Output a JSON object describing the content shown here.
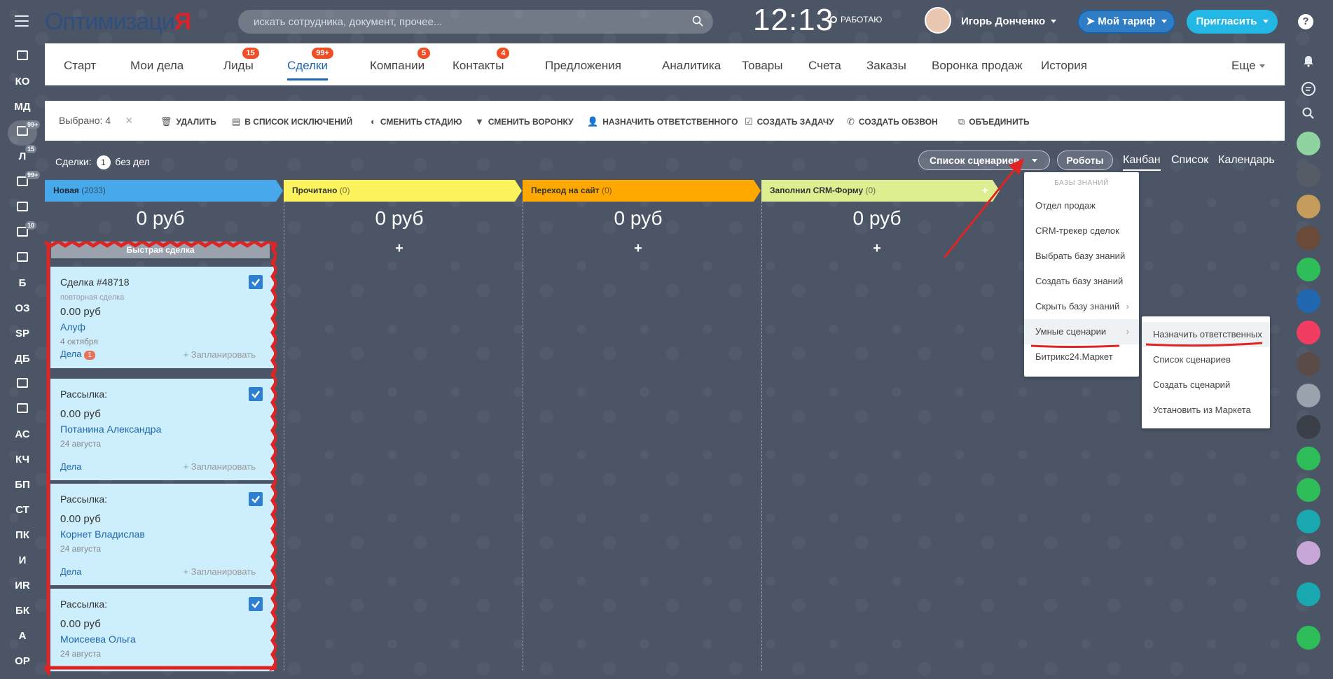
{
  "header": {
    "logo_part1": "Оптимизаци",
    "logo_part2": "Я",
    "search_placeholder": "искать сотрудника, документ, прочее...",
    "time": "12:13",
    "status": "РАБОТАЮ",
    "user_name": "Игорь Донченко",
    "tariff_label": "Мой тариф",
    "invite_label": "Пригласить",
    "help": "?"
  },
  "leftbar": [
    {
      "label": "",
      "type": "icon",
      "icon": "monitor-icon"
    },
    {
      "label": "КО"
    },
    {
      "label": "МД"
    },
    {
      "label": "",
      "type": "icon",
      "icon": "filter-icon",
      "badge": "99+",
      "active": true
    },
    {
      "label": "Л",
      "badge": "15"
    },
    {
      "label": "",
      "type": "icon",
      "icon": "checkbox-icon",
      "badge": "99+"
    },
    {
      "label": "",
      "type": "icon",
      "icon": "book-icon"
    },
    {
      "label": "",
      "type": "icon",
      "icon": "mail-icon",
      "badge": "10"
    },
    {
      "label": "",
      "type": "icon",
      "icon": "robot-icon"
    },
    {
      "label": "Б"
    },
    {
      "label": "ОЗ"
    },
    {
      "label": "SP"
    },
    {
      "label": "ДБ"
    },
    {
      "label": "",
      "type": "icon",
      "icon": "card-icon"
    },
    {
      "label": "",
      "type": "icon",
      "icon": "document-icon"
    },
    {
      "label": "АС"
    },
    {
      "label": "КЧ"
    },
    {
      "label": "БП"
    },
    {
      "label": "СТ"
    },
    {
      "label": "ПК"
    },
    {
      "label": "И"
    },
    {
      "label": "ИR"
    },
    {
      "label": "БК"
    },
    {
      "label": "А"
    },
    {
      "label": "ОР"
    }
  ],
  "tabs": [
    {
      "label": "Старт"
    },
    {
      "label": "Мои дела"
    },
    {
      "label": "Лиды",
      "badge": "15"
    },
    {
      "label": "Сделки",
      "badge": "99+",
      "active": true
    },
    {
      "label": "Компании",
      "badge": "5"
    },
    {
      "label": "Контакты",
      "badge": "4"
    },
    {
      "label": "Предложения"
    },
    {
      "label": "Аналитика"
    },
    {
      "label": "Товары"
    },
    {
      "label": "Счета"
    },
    {
      "label": "Заказы"
    },
    {
      "label": "Воронка продаж"
    },
    {
      "label": "История"
    },
    {
      "label": "Еще"
    }
  ],
  "actions": {
    "selected": "Выбрано: 4",
    "close": "×",
    "items": [
      {
        "label": "УДАЛИТЬ",
        "icon": "trash-icon"
      },
      {
        "label": "В СПИСОК ИСКЛЮЧЕНИЙ",
        "icon": "list-icon"
      },
      {
        "label": "СМЕНИТЬ СТАДИЮ",
        "icon": "stage-icon"
      },
      {
        "label": "СМЕНИТЬ ВОРОНКУ",
        "icon": "funnel-icon"
      },
      {
        "label": "НАЗНАЧИТЬ ОТВЕТСТВЕННОГО",
        "icon": "person-icon"
      },
      {
        "label": "СОЗДАТЬ ЗАДАЧУ",
        "icon": "task-icon"
      },
      {
        "label": "СОЗДАТЬ ОБЗВОН",
        "icon": "phone-icon"
      },
      {
        "label": "ОБЪЕДИНИТЬ",
        "icon": "merge-icon"
      }
    ]
  },
  "toolbar": {
    "deals_prefix": "Сделки:",
    "deals_count": "1",
    "deals_suffix": "без дел",
    "scenarios_label": "Список сценариев",
    "robots_label": "Роботы",
    "views": [
      "Канбан",
      "Список",
      "Календарь"
    ]
  },
  "columns": [
    {
      "name": "Новая",
      "count": "(2033)",
      "sum": "0 руб",
      "color": "#47a8ea",
      "text_color": "#1a2a3a"
    },
    {
      "name": "Прочитано",
      "count": "(0)",
      "sum": "0 руб",
      "color": "#fdf35c",
      "text_color": "#333"
    },
    {
      "name": "Переход на сайт",
      "count": "(0)",
      "sum": "0 руб",
      "color": "#ffa900",
      "text_color": "#333"
    },
    {
      "name": "Заполнил CRM-Форму",
      "count": "(0)",
      "sum": "0 руб",
      "color": "#dcee8f",
      "text_color": "#333"
    }
  ],
  "add_symbol": "+",
  "quick_deal": "Быстрая сделка",
  "cards": [
    {
      "title": "Сделка #48718",
      "subtitle": "повторная сделка",
      "sum": "0.00 руб",
      "client": "Алуф",
      "date": "4 октября",
      "deals": "Дела",
      "deals_badge": "1",
      "plan": "+ Запланировать"
    },
    {
      "title": "Рассылка:",
      "subtitle": "",
      "sum": "0.00 руб",
      "client": "Потанина Александра",
      "date": "24 августа",
      "deals": "Дела",
      "deals_badge": "",
      "plan": "+ Запланировать"
    },
    {
      "title": "Рассылка:",
      "subtitle": "",
      "sum": "0.00 руб",
      "client": "Корнет Владислав",
      "date": "24 августа",
      "deals": "Дела",
      "deals_badge": "",
      "plan": "+ Запланировать"
    },
    {
      "title": "Рассылка:",
      "subtitle": "",
      "sum": "0.00 руб",
      "client": "Моисеева Ольга",
      "date": "24 августа",
      "deals": "",
      "deals_badge": "",
      "plan": ""
    }
  ],
  "menu1": {
    "header": "БАЗЫ ЗНАНИЙ",
    "items": [
      {
        "label": "Отдел продаж"
      },
      {
        "label": "CRM-трекер сделок"
      },
      {
        "label": "Выбрать базу знаний"
      },
      {
        "label": "Создать базу знаний"
      },
      {
        "label": "Скрыть базу знаний",
        "arrow": "›"
      },
      {
        "label": "Умные сценарии",
        "arrow": "›",
        "highlight": true
      },
      {
        "label": "Битрикс24.Маркет"
      }
    ]
  },
  "menu2": {
    "items": [
      {
        "label": "Назначить ответственных"
      },
      {
        "label": "Список сценариев"
      },
      {
        "label": "Создать сценарий"
      },
      {
        "label": "Установить из Маркета"
      }
    ]
  },
  "colors": {
    "accent": "#2067b0",
    "annotation": "#e02424",
    "card_bg": "#cdeefc"
  }
}
